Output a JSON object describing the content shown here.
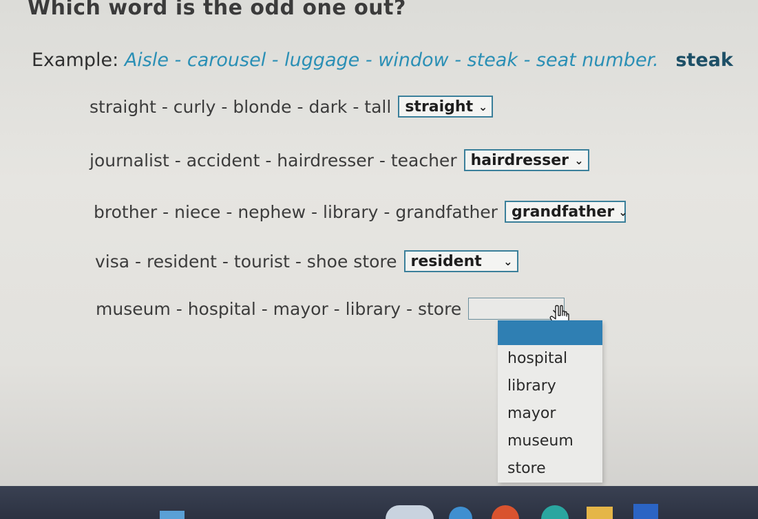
{
  "page": {
    "title": "Which word is the odd one out?"
  },
  "example": {
    "label": "Example:",
    "words": "Aisle - carousel - luggage - window - steak - seat number.",
    "answer": "steak"
  },
  "questions": [
    {
      "words": "straight - curly - blonde - dark - tall",
      "selected": "straight"
    },
    {
      "words": "journalist - accident - hairdresser - teacher",
      "selected": "hairdresser"
    },
    {
      "words": "brother - niece - nephew - library - grandfather",
      "selected": "grandfather"
    },
    {
      "words": "visa - resident - tourist - shoe store",
      "selected": "resident"
    },
    {
      "words": "museum - hospital - mayor - library - store",
      "selected": ""
    }
  ],
  "dropdown": {
    "options": [
      "hospital",
      "library",
      "mayor",
      "museum",
      "store"
    ]
  },
  "icons": {
    "chevron": "chevron-down-icon",
    "cursor": "hand-pointer-icon"
  },
  "colors": {
    "example_words": "#2a8fb5",
    "example_answer": "#1d4f66",
    "select_border": "#3a7f9a",
    "dropdown_highlight": "#2f7fb3",
    "taskbar": "#2c3242"
  }
}
